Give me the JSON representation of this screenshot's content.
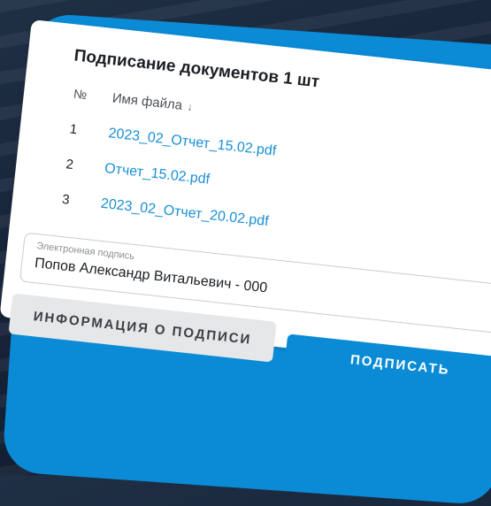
{
  "dialog": {
    "title": "Подписание документов 1 шт",
    "col_no": "№",
    "col_name": "Имя файла",
    "sort_icon": "↓",
    "rows": [
      {
        "no": "1",
        "file": "2023_02_Отчет_15.02.pdf"
      },
      {
        "no": "2",
        "file": "Отчет_15.02.pdf"
      },
      {
        "no": "3",
        "file": "2023_02_Отчет_20.02.pdf"
      }
    ],
    "signature": {
      "label": "Электронная подпись",
      "value": "Попов Александр Витальевич - 000"
    },
    "buttons": {
      "info": "ИНФОРМАЦИЯ О ПОДПИСИ",
      "sign": "ПОДПИСАТЬ"
    }
  },
  "colors": {
    "accent": "#0b8bd6",
    "link": "#1a8fd6",
    "background": "#17243a"
  }
}
